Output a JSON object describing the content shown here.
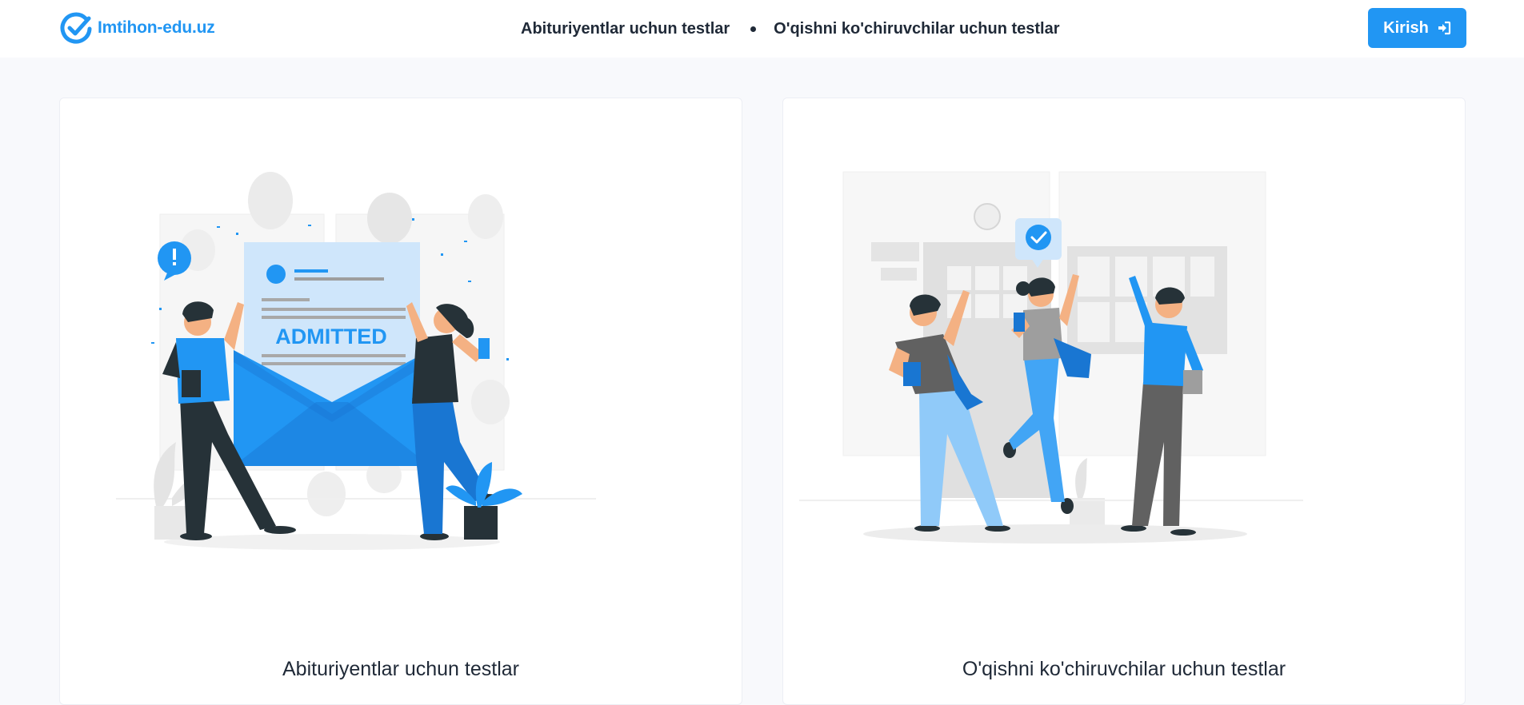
{
  "header": {
    "brand_name": "Imtihon-edu.uz",
    "nav": [
      {
        "label": "Abituriyentlar uchun testlar"
      },
      {
        "label": "O'qishni ko'chiruvchilar uchun testlar"
      }
    ],
    "login_label": "Kirish"
  },
  "cards": [
    {
      "title": "Abituriyentlar uchun testlar",
      "illustration_text": "ADMITTED"
    },
    {
      "title": "O'qishni ko'chiruvchilar uchun testlar"
    }
  ],
  "colors": {
    "accent": "#2196f3",
    "text": "#1f2937",
    "background": "#f8f9fc"
  }
}
